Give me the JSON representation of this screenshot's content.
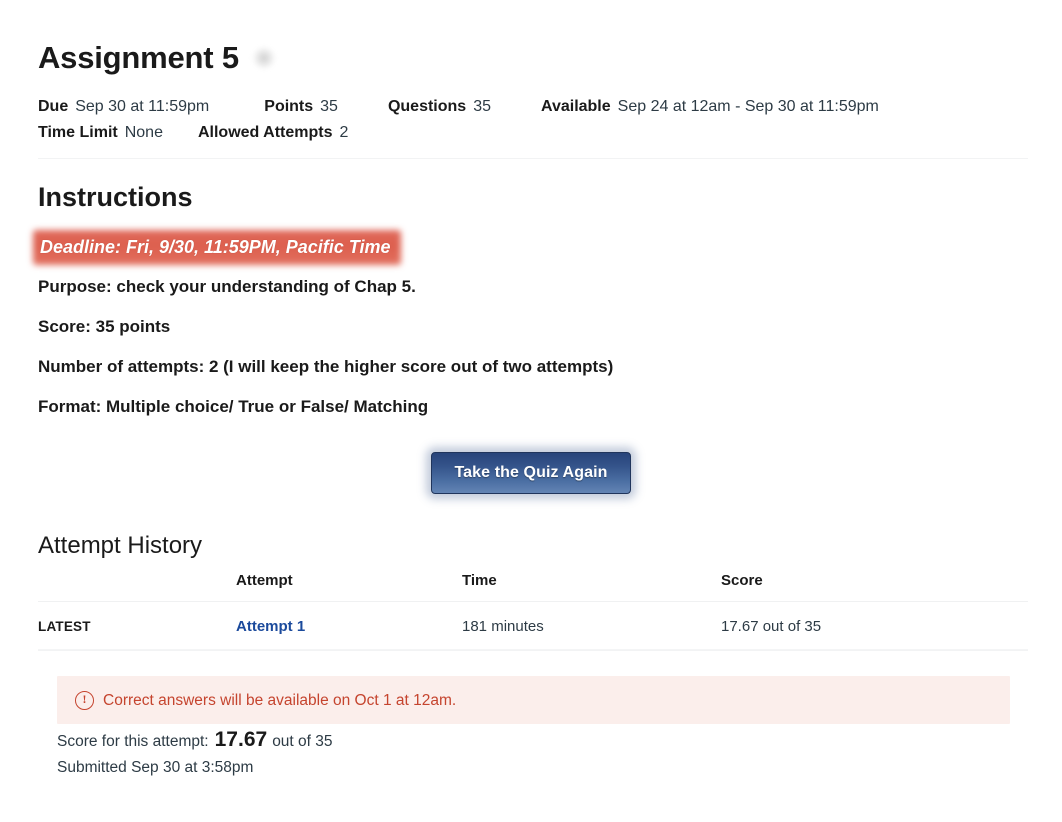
{
  "quiz": {
    "title": "Assignment 5",
    "publish_icon": "published-status-icon"
  },
  "details": {
    "due_label": "Due",
    "due_value": "Sep 30 at 11:59pm",
    "points_label": "Points",
    "points_value": "35",
    "questions_label": "Questions",
    "questions_value": "35",
    "available_label": "Available",
    "available_value": "Sep 24 at 12am - Sep 30 at 11:59pm",
    "time_limit_label": "Time Limit",
    "time_limit_value": "None",
    "allowed_attempts_label": "Allowed Attempts",
    "allowed_attempts_value": "2"
  },
  "instructions": {
    "heading": "Instructions",
    "deadline": "Deadline: Fri, 9/30, 11:59PM, Pacific Time",
    "lines": [
      "Purpose: check your understanding of Chap 5.",
      "Score: 35 points",
      "Number of attempts: 2 (I will keep the higher score out of two attempts)",
      "Format: Multiple choice/ True or False/ Matching"
    ]
  },
  "actions": {
    "take_quiz_again": "Take the Quiz Again"
  },
  "attempt_history": {
    "heading": "Attempt History",
    "columns": {
      "kept": "",
      "attempt": "Attempt",
      "time": "Time",
      "score": "Score"
    },
    "rows": [
      {
        "kept": "LATEST",
        "attempt": "Attempt 1",
        "time": "181 minutes",
        "score": "17.67 out of 35"
      }
    ]
  },
  "alert": {
    "icon": "exclamation-circle-icon",
    "message": "Correct answers will be available on Oct 1 at 12am.",
    "color": "#c5442e",
    "background": "#fbeeeb"
  },
  "score_summary": {
    "prefix": "Score for this attempt:",
    "value": "17.67",
    "suffix": "out of 35",
    "submitted": "Submitted Sep 30 at 3:58pm"
  },
  "colors": {
    "link": "#1b4a9c",
    "button_top": "#27447a",
    "button_bottom": "#6384b4",
    "highlight_red": "#dd5f4e"
  }
}
